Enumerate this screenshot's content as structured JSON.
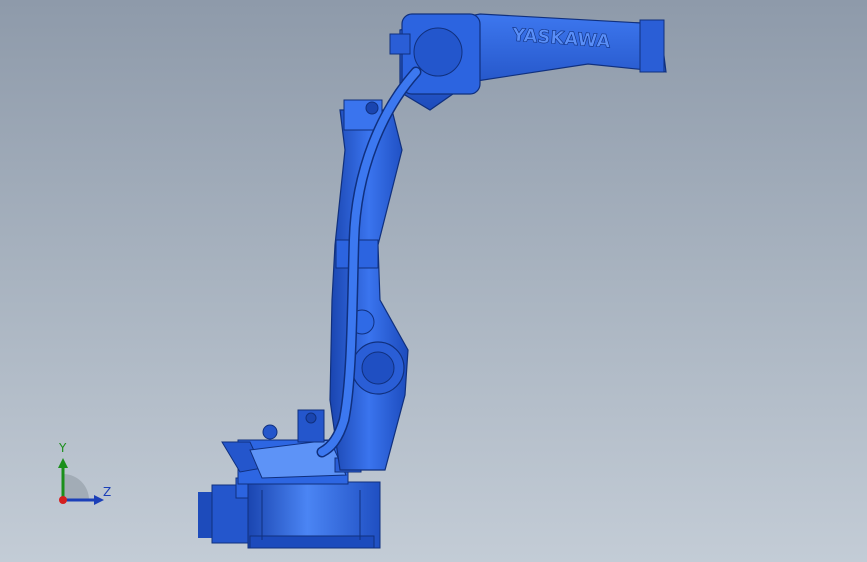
{
  "model": {
    "brand_text": "YASKAWA"
  },
  "triad": {
    "y_label": "Y",
    "z_label": "Z"
  },
  "colors": {
    "background_top": "#8e9aaa",
    "background_bottom": "#c3ccd6",
    "robot_body": "#2c64e0",
    "robot_shadow": "#1a45b0",
    "robot_highlight": "#4d86f5",
    "cable": "#2a5ed6",
    "axis_y": "#1b8f1b",
    "axis_z": "#1b3fb8",
    "axis_x_origin": "#d41f1f"
  },
  "icons": {
    "view_triad": "coordinate-triad-icon"
  }
}
